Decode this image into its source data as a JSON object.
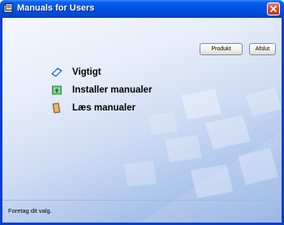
{
  "window": {
    "title": "Manuals for Users"
  },
  "toolbar": {
    "product_label": "Produkt",
    "exit_label": "Afslut"
  },
  "menu": {
    "items": [
      {
        "label": "Vigtigt",
        "icon": "important-book-icon"
      },
      {
        "label": "Installer manualer",
        "icon": "install-manuals-icon"
      },
      {
        "label": "Læs manualer",
        "icon": "read-manuals-icon"
      }
    ]
  },
  "status": {
    "text": "Foretag dit valg."
  },
  "colors": {
    "titlebar": "#0054e3",
    "close_button": "#d8472a",
    "client_background": "#cddbf3"
  }
}
